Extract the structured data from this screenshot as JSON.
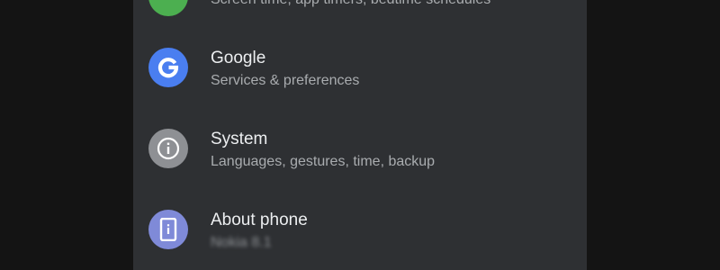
{
  "settings": {
    "items": [
      {
        "title": "",
        "subtitle": "Screen time, app timers, bedtime schedules",
        "icon": "digital-wellbeing-icon",
        "color": "#4caf50"
      },
      {
        "title": "Google",
        "subtitle": "Services & preferences",
        "icon": "google-g-icon",
        "color": "#4a7ef0"
      },
      {
        "title": "System",
        "subtitle": "Languages, gestures, time, backup",
        "icon": "info-icon",
        "color": "#8e9094"
      },
      {
        "title": "About phone",
        "subtitle": "Nokia 8.1",
        "icon": "phone-icon",
        "color": "#7f8ad8"
      }
    ]
  }
}
